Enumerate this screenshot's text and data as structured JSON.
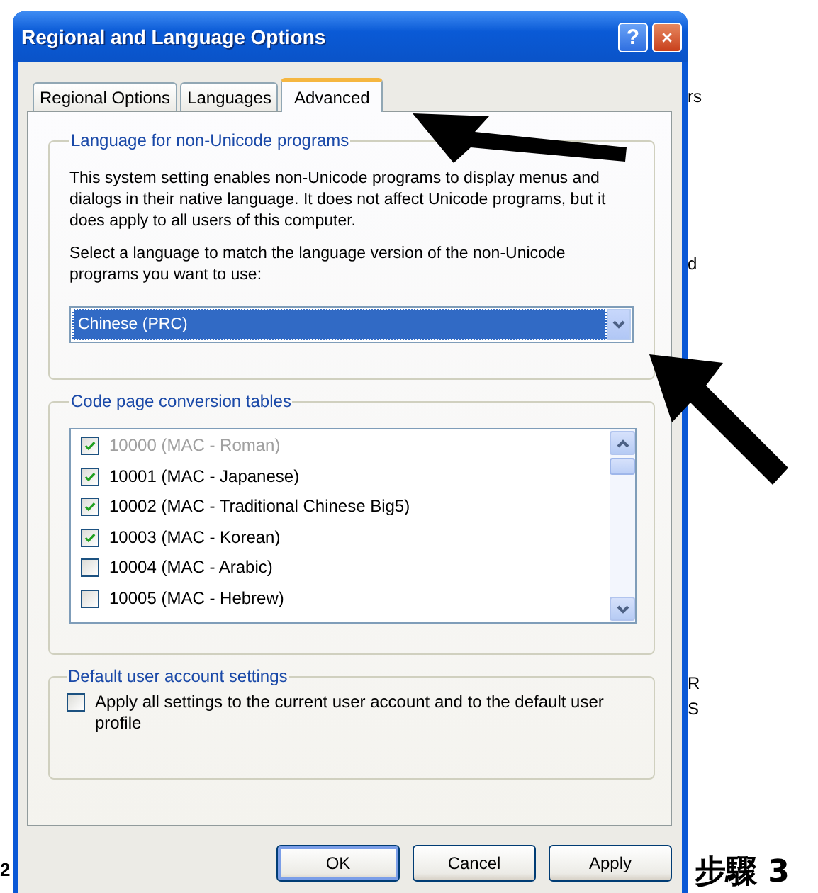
{
  "window": {
    "title": "Regional and Language Options",
    "help_button": "?"
  },
  "tabs": [
    {
      "label": "Regional Options",
      "selected": false
    },
    {
      "label": "Languages",
      "selected": false
    },
    {
      "label": "Advanced",
      "selected": true
    }
  ],
  "language_group": {
    "title": "Language for non-Unicode programs",
    "description": "This system setting enables non-Unicode programs to display menus and dialogs in their native language. It does not affect Unicode programs, but it does apply to all users of this computer.",
    "prompt": "Select a language to match the language version of the non-Unicode programs you want to use:",
    "dropdown": {
      "value": "Chinese (PRC)"
    }
  },
  "code_page_group": {
    "title": "Code page conversion tables",
    "items": [
      {
        "label": "10000 (MAC - Roman)",
        "checked": true,
        "disabled": true
      },
      {
        "label": "10001 (MAC - Japanese)",
        "checked": true,
        "disabled": false
      },
      {
        "label": "10002 (MAC - Traditional Chinese Big5)",
        "checked": true,
        "disabled": false
      },
      {
        "label": "10003 (MAC - Korean)",
        "checked": true,
        "disabled": false
      },
      {
        "label": "10004 (MAC - Arabic)",
        "checked": false,
        "disabled": false
      },
      {
        "label": "10005 (MAC - Hebrew)",
        "checked": false,
        "disabled": false
      }
    ]
  },
  "user_group": {
    "title": "Default user account settings",
    "checkbox": {
      "label": "Apply all settings to the current user account and to the default user profile",
      "checked": false
    }
  },
  "buttons": [
    {
      "label": "OK",
      "default": true
    },
    {
      "label": "Cancel",
      "default": false
    },
    {
      "label": "Apply",
      "default": false
    }
  ],
  "document": {
    "fragments": [
      "rs",
      "d",
      "R",
      "S"
    ],
    "left_text": "2",
    "right_text": "步驟 3"
  }
}
